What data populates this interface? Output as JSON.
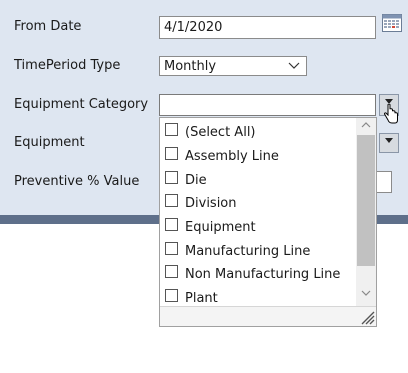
{
  "form": {
    "from_date_label": "From Date",
    "from_date_value": "4/1/2020",
    "timeperiod_label": "TimePeriod Type",
    "timeperiod_value": "Monthly",
    "equipment_category_label": "Equipment Category",
    "equipment_category_value": "",
    "equipment_label": "Equipment",
    "preventive_label": "Preventive % Value"
  },
  "icons": {
    "calendar": "calendar-icon",
    "select_chevron": "chevron-down-icon",
    "dropdown_arrow": "dropdown-arrow-icon",
    "cursor": "hand-cursor-icon",
    "resize": "resize-grip-icon"
  },
  "dropdown": {
    "items": [
      {
        "label": "(Select All)",
        "checked": false
      },
      {
        "label": "Assembly Line",
        "checked": false
      },
      {
        "label": "Die",
        "checked": false
      },
      {
        "label": "Division",
        "checked": false
      },
      {
        "label": "Equipment",
        "checked": false
      },
      {
        "label": "Manufacturing Line",
        "checked": false
      },
      {
        "label": "Non Manufacturing Line",
        "checked": false
      },
      {
        "label": "Plant",
        "checked": false
      }
    ]
  },
  "colors": {
    "panel_bg": "#dee6f1",
    "separator": "#5e6f8a",
    "scroll_thumb": "#c1c1c1"
  }
}
